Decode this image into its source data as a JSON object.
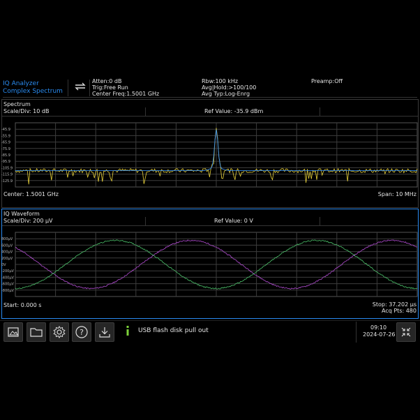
{
  "header": {
    "mode_line1": "IQ Analyzer",
    "mode_line2": "Complex Spectrum",
    "atten": "Atten:0 dB",
    "trig": "Trig:Free Run",
    "center_freq": "Center Freq:1.5001 GHz",
    "rbw": "Rbw:100 kHz",
    "avg_hold": "Avg|Hold:>100/100",
    "avg_type": "Avg Typ:Log-Enrg",
    "preamp": "Preamp:Off"
  },
  "spectrum": {
    "title": "Spectrum",
    "scale": "Scale/Div: 10 dB",
    "ref": "Ref Value: -35.9 dBm",
    "y_ticks": [
      "-45.9",
      "-55.9",
      "-65.9",
      "-75.9",
      "-85.9",
      "-95.9",
      "-105.9",
      "-115.9",
      "-125.9"
    ],
    "center": "Center: 1.5001 GHz",
    "span": "Span: 10 MHz",
    "trace_color": "#e8d23a",
    "avg_color": "#3a8ee8"
  },
  "iq": {
    "title": "IQ Waveform",
    "scale": "Scale/Div: 200 µV",
    "ref": "Ref Value: 0 V",
    "y_ticks": [
      "800µV",
      "600µV",
      "400µV",
      "200µV",
      "0V",
      "-200µV",
      "-400µV",
      "-600µV",
      "-800µV"
    ],
    "start": "Start: 0.000 s",
    "stop": "Stop: 37.202 µs",
    "acq": "Acq Pts: 480",
    "i_color": "#b04cd0",
    "q_color": "#4cc06a"
  },
  "toolbar": {
    "message": "USB flash disk pull out",
    "time": "09:10",
    "date": "2024-07-26",
    "icons": [
      "screenshot-icon",
      "folder-icon",
      "gear-icon",
      "help-icon",
      "download-icon",
      "info-icon",
      "shrink-icon"
    ]
  },
  "chart_data": [
    {
      "type": "line",
      "title": "Spectrum",
      "ylabel": "dBm",
      "ylim": [
        -125.9,
        -35.9
      ],
      "y_ticks": [
        -45.9,
        -55.9,
        -65.9,
        -75.9,
        -85.9,
        -95.9,
        -105.9,
        -115.9,
        -125.9
      ],
      "x_center": "1.5001 GHz",
      "x_span": "10 MHz",
      "series": [
        {
          "name": "",
          "noise_floor": -103,
          "peak_value": -48,
          "peak_pos": 0.5
        }
      ]
    },
    {
      "type": "line",
      "title": "IQ Waveform",
      "ylim": [
        -800,
        800
      ],
      "xlim": [
        0,
        37.202
      ],
      "points": 480,
      "series": [
        {
          "name": "",
          "amplitude": 600,
          "cycles": 2,
          "phase": 1.25
        },
        {
          "name": "",
          "amplitude": 600,
          "cycles": 2,
          "phase": 0
        }
      ]
    }
  ]
}
